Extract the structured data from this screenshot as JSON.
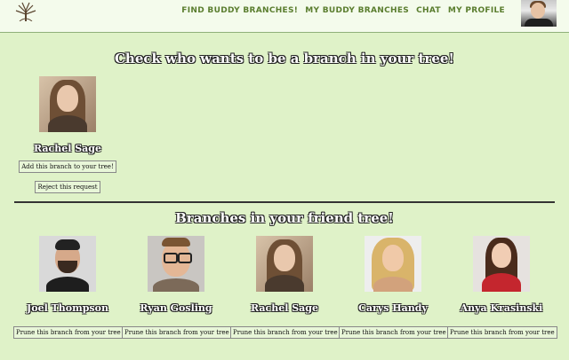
{
  "nav": {
    "find_buddy": "FIND BUDDY BRANCHES!",
    "my_buddy": "MY BUDDY BRANCHES",
    "chat": "CHAT",
    "profile": "MY PROFILE"
  },
  "requests": {
    "heading": "Check who wants to be a branch in your tree!",
    "items": [
      {
        "name": "Rachel Sage",
        "add_label": "Add this branch to your tree!",
        "reject_label": "Reject this request"
      }
    ]
  },
  "friends": {
    "heading": "Branches in your friend tree!",
    "items": [
      {
        "name": "Joel Thompson",
        "prune_label": "Prune this branch from your tree"
      },
      {
        "name": "Ryan Gosling",
        "prune_label": "Prune this branch from your tree"
      },
      {
        "name": "Rachel Sage",
        "prune_label": "Prune this branch from your tree"
      },
      {
        "name": "Carys Handy",
        "prune_label": "Prune this branch from your tree"
      },
      {
        "name": "Anya Krasinski",
        "prune_label": "Prune this branch from your tree"
      }
    ]
  },
  "colors": {
    "background": "#dff2c8",
    "topbar": "#f4fbec",
    "nav_text": "#5a7d2e"
  },
  "icons": {
    "logo": "tree-logo-icon"
  }
}
